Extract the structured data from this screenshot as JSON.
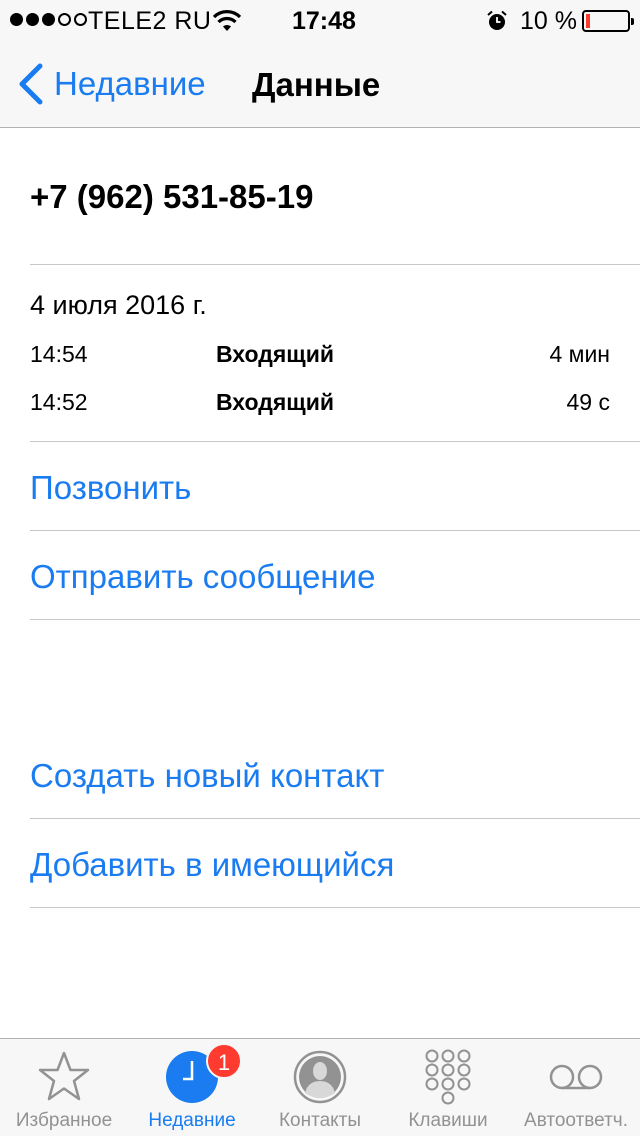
{
  "status_bar": {
    "carrier": "TELE2 RU",
    "time": "17:48",
    "battery_percent": "10 %",
    "signal_bars_filled": 3,
    "signal_bars_total": 5,
    "battery_level": 0.1
  },
  "nav": {
    "back_label": "Недавние",
    "title": "Данные"
  },
  "contact": {
    "phone_number": "+7 (962) 531-85-19"
  },
  "calls": {
    "date": "4 июля 2016 г.",
    "items": [
      {
        "time": "14:54",
        "type": "Входящий",
        "duration": "4 мин"
      },
      {
        "time": "14:52",
        "type": "Входящий",
        "duration": "49 с"
      }
    ]
  },
  "actions": {
    "call": "Позвонить",
    "message": "Отправить сообщение",
    "create_contact": "Создать новый контакт",
    "add_existing": "Добавить в имеющийся"
  },
  "tab_bar": {
    "tabs": [
      {
        "label": "Избранное",
        "icon": "star-icon"
      },
      {
        "label": "Недавние",
        "icon": "clock-icon",
        "badge": "1",
        "active": true
      },
      {
        "label": "Контакты",
        "icon": "person-icon"
      },
      {
        "label": "Клавиши",
        "icon": "keypad-icon"
      },
      {
        "label": "Автоответч.",
        "icon": "voicemail-icon"
      }
    ]
  },
  "colors": {
    "accent": "#1a7cf0",
    "badge": "#ff3b30",
    "bar_background": "#f7f7f7",
    "inactive_tab": "#929292"
  }
}
